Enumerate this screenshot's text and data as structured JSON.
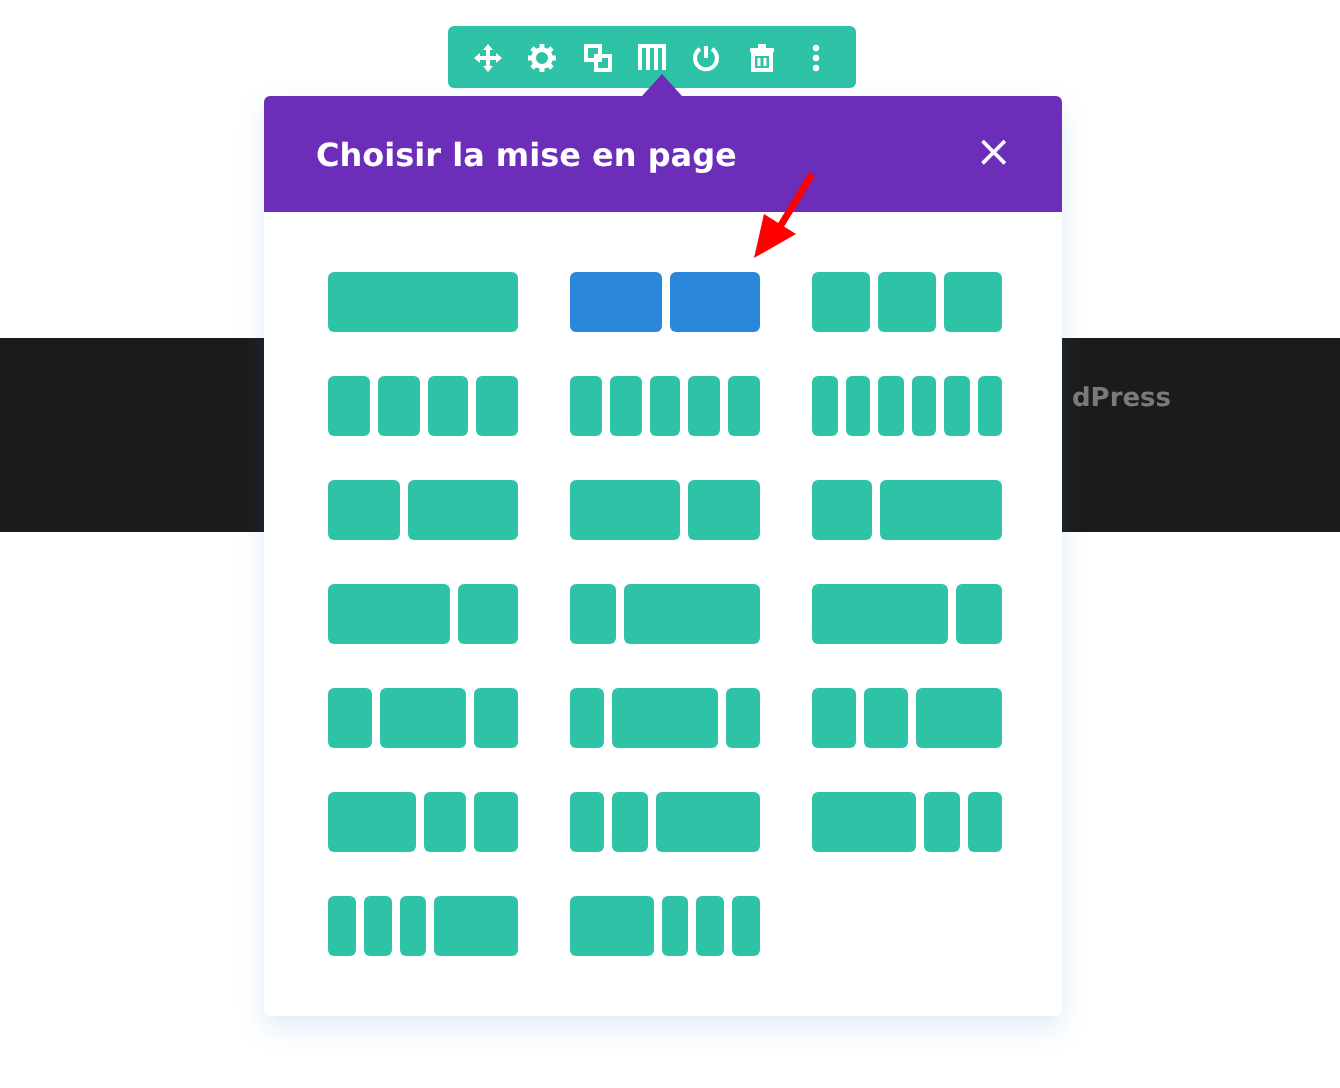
{
  "background": {
    "band_text": "dPress"
  },
  "modal": {
    "title": "Choisir la mise en page",
    "close": "×",
    "layouts": [
      {
        "columns": [
          {
            "kind": "full"
          }
        ],
        "selected": false
      },
      {
        "columns": [
          {
            "kind": "half"
          },
          {
            "kind": "half"
          }
        ],
        "selected": true
      },
      {
        "columns": [
          {
            "kind": "third"
          },
          {
            "kind": "third"
          },
          {
            "kind": "third"
          }
        ],
        "selected": false
      },
      {
        "columns": [
          {
            "kind": "quarter"
          },
          {
            "kind": "quarter"
          },
          {
            "kind": "quarter"
          },
          {
            "kind": "quarter"
          }
        ],
        "selected": false
      },
      {
        "columns": [
          {
            "kind": "fifth"
          },
          {
            "kind": "fifth"
          },
          {
            "kind": "fifth"
          },
          {
            "kind": "fifth"
          },
          {
            "kind": "fifth"
          }
        ],
        "selected": false
      },
      {
        "columns": [
          {
            "kind": "sixth"
          },
          {
            "kind": "sixth"
          },
          {
            "kind": "sixth"
          },
          {
            "kind": "sixth"
          },
          {
            "kind": "sixth"
          },
          {
            "kind": "sixth"
          }
        ],
        "selected": false
      },
      {
        "columns": [
          {
            "kind": "two-fifths"
          },
          {
            "kind": "three-fifths"
          }
        ],
        "selected": false
      },
      {
        "columns": [
          {
            "kind": "three-fifths"
          },
          {
            "kind": "two-fifths"
          }
        ],
        "selected": false
      },
      {
        "columns": [
          {
            "kind": "third"
          },
          {
            "kind": "two-thirds"
          }
        ],
        "selected": false
      },
      {
        "columns": [
          {
            "kind": "two-thirds"
          },
          {
            "kind": "third"
          }
        ],
        "selected": false
      },
      {
        "columns": [
          {
            "kind": "quarter"
          },
          {
            "kind": "three-quarters"
          }
        ],
        "selected": false
      },
      {
        "columns": [
          {
            "kind": "three-quarters"
          },
          {
            "kind": "quarter"
          }
        ],
        "selected": false
      },
      {
        "columns": [
          {
            "kind": "quarter"
          },
          {
            "kind": "half"
          },
          {
            "kind": "quarter"
          }
        ],
        "selected": false
      },
      {
        "columns": [
          {
            "kind": "fifth"
          },
          {
            "kind": "three-fifths"
          },
          {
            "kind": "fifth"
          }
        ],
        "selected": false
      },
      {
        "columns": [
          {
            "kind": "quarter"
          },
          {
            "kind": "quarter"
          },
          {
            "kind": "half"
          }
        ],
        "selected": false
      },
      {
        "columns": [
          {
            "kind": "half"
          },
          {
            "kind": "quarter"
          },
          {
            "kind": "quarter"
          }
        ],
        "selected": false
      },
      {
        "columns": [
          {
            "kind": "fifth"
          },
          {
            "kind": "fifth"
          },
          {
            "kind": "three-fifths"
          }
        ],
        "selected": false
      },
      {
        "columns": [
          {
            "kind": "three-fifths"
          },
          {
            "kind": "fifth"
          },
          {
            "kind": "fifth"
          }
        ],
        "selected": false
      },
      {
        "columns": [
          {
            "kind": "sixth"
          },
          {
            "kind": "sixth"
          },
          {
            "kind": "sixth"
          },
          {
            "kind": "half"
          }
        ],
        "selected": false
      },
      {
        "columns": [
          {
            "kind": "half"
          },
          {
            "kind": "sixth"
          },
          {
            "kind": "sixth"
          },
          {
            "kind": "sixth"
          }
        ],
        "selected": false
      }
    ]
  }
}
